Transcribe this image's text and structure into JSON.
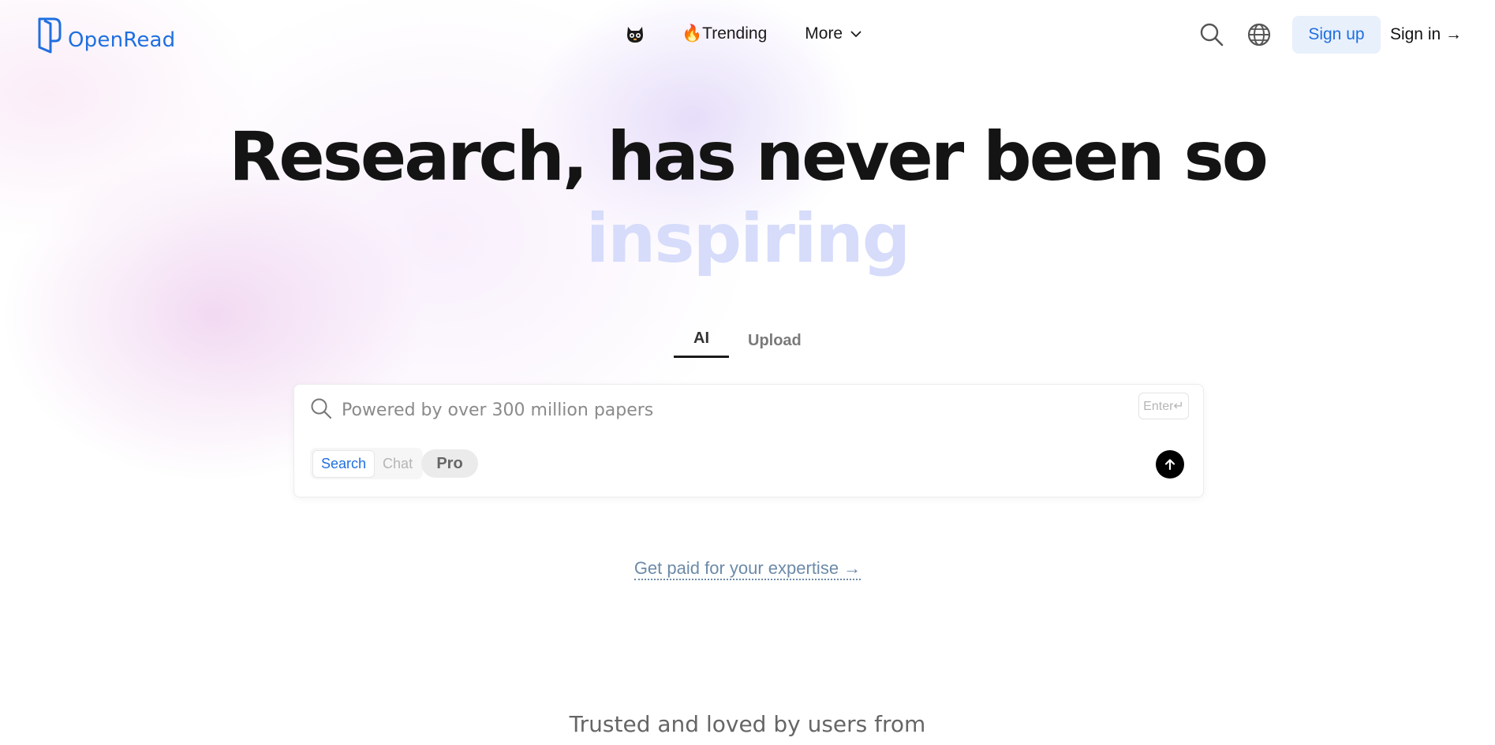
{
  "header": {
    "brand": "OpenRead",
    "nav": {
      "trending_label": "🔥Trending",
      "more_label": "More"
    },
    "signup_label": "Sign up",
    "signin_label": "Sign in →"
  },
  "hero": {
    "title": "Research, has never been so",
    "subtitle": "inspiring"
  },
  "tabs": [
    {
      "label": "AI",
      "active": true
    },
    {
      "label": "Upload",
      "active": false
    }
  ],
  "search": {
    "placeholder": "Powered by over 300 million papers",
    "value": "",
    "enter_hint": "Enter↵",
    "modes": [
      {
        "label": "Search",
        "active": true
      },
      {
        "label": "Chat",
        "active": false
      }
    ],
    "pro_label": "Pro"
  },
  "expertise_link": "Get paid for your expertise →",
  "trusted_heading": "Trusted and loved by users from",
  "colors": {
    "brand_blue": "#1f6fe0",
    "signup_bg": "#e8f0fc",
    "subtitle_color": "#d6dcfa",
    "link_color": "#6c8aa8"
  },
  "icons": [
    "openread-logo-icon",
    "cat-mascot-icon",
    "chevron-down-icon",
    "search-icon",
    "globe-icon",
    "arrow-up-icon"
  ]
}
